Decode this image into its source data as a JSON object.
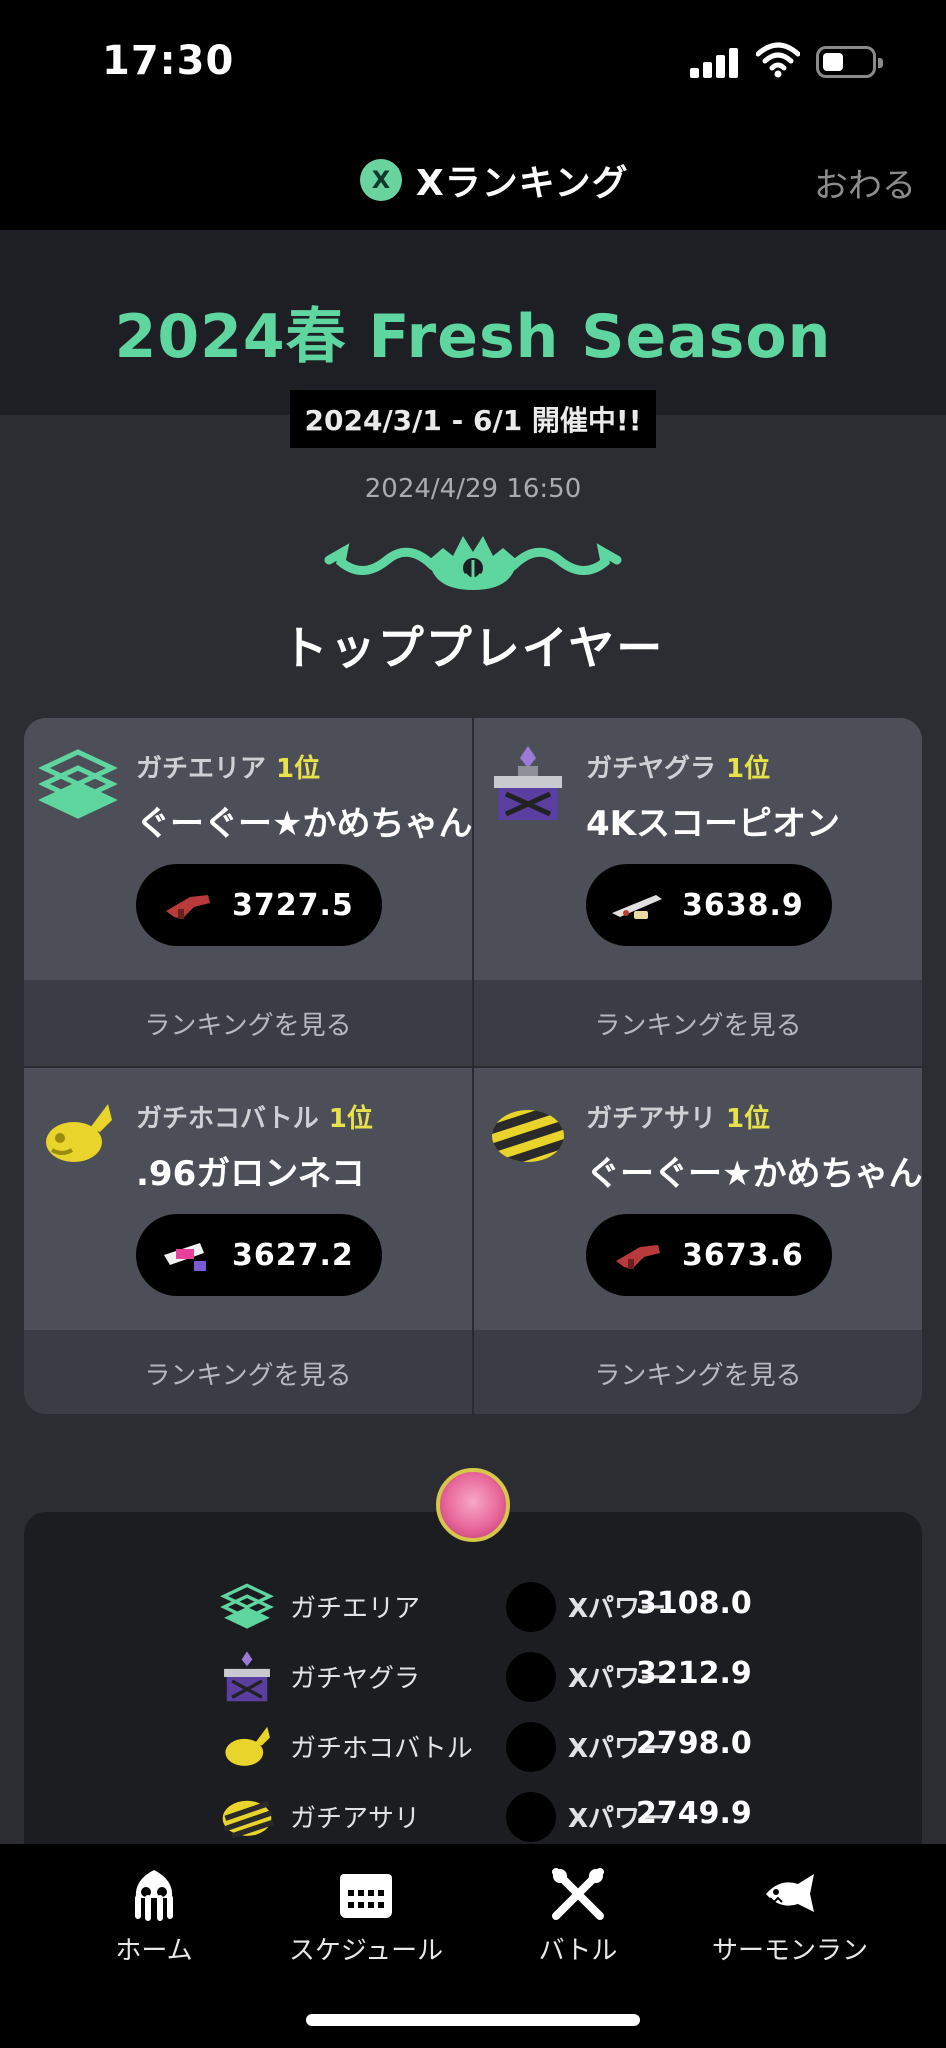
{
  "status_bar": {
    "time": "17:30"
  },
  "header": {
    "title": "Xランキング",
    "badge": "X",
    "close_label": "おわる"
  },
  "season": {
    "title": "2024春 Fresh Season",
    "dates": "2024/3/1 - 6/1 開催中!!",
    "updated": "2024/4/29 16:50"
  },
  "top_player": {
    "title": "トッププレイヤー"
  },
  "colors": {
    "accent": "#5fd6a0",
    "rank": "#e8e24a",
    "background": "#2c2d33"
  },
  "rankings": [
    {
      "mode": "ガチエリア",
      "rank": "1位",
      "player": "ぐーぐー★かめちゃん",
      "power": "3727.5",
      "link": "ランキングを見る",
      "icon": "splat-zones-icon"
    },
    {
      "mode": "ガチヤグラ",
      "rank": "1位",
      "player": "4Kスコーピオン",
      "power": "3638.9",
      "link": "ランキングを見る",
      "icon": "tower-control-icon"
    },
    {
      "mode": "ガチホコバトル",
      "rank": "1位",
      "player": ".96ガロンネコ",
      "power": "3627.2",
      "link": "ランキングを見る",
      "icon": "rainmaker-icon"
    },
    {
      "mode": "ガチアサリ",
      "rank": "1位",
      "player": "ぐーぐー★かめちゃん",
      "power": "3673.6",
      "link": "ランキングを見る",
      "icon": "clam-blitz-icon"
    }
  ],
  "my_player": {
    "rows": [
      {
        "mode": "ガチエリア",
        "label": "Xパワー",
        "value": "3108.0"
      },
      {
        "mode": "ガチヤグラ",
        "label": "Xパワー",
        "value": "3212.9"
      },
      {
        "mode": "ガチホコバトル",
        "label": "Xパワー",
        "value": "2798.0"
      },
      {
        "mode": "ガチアサリ",
        "label": "Xパワー",
        "value": "2749.9"
      }
    ]
  },
  "tabs": [
    {
      "label": "ホーム",
      "icon": "squid-icon"
    },
    {
      "label": "スケジュール",
      "icon": "calendar-icon"
    },
    {
      "label": "バトル",
      "icon": "crossed-weapons-icon"
    },
    {
      "label": "サーモンラン",
      "icon": "salmon-icon"
    }
  ]
}
